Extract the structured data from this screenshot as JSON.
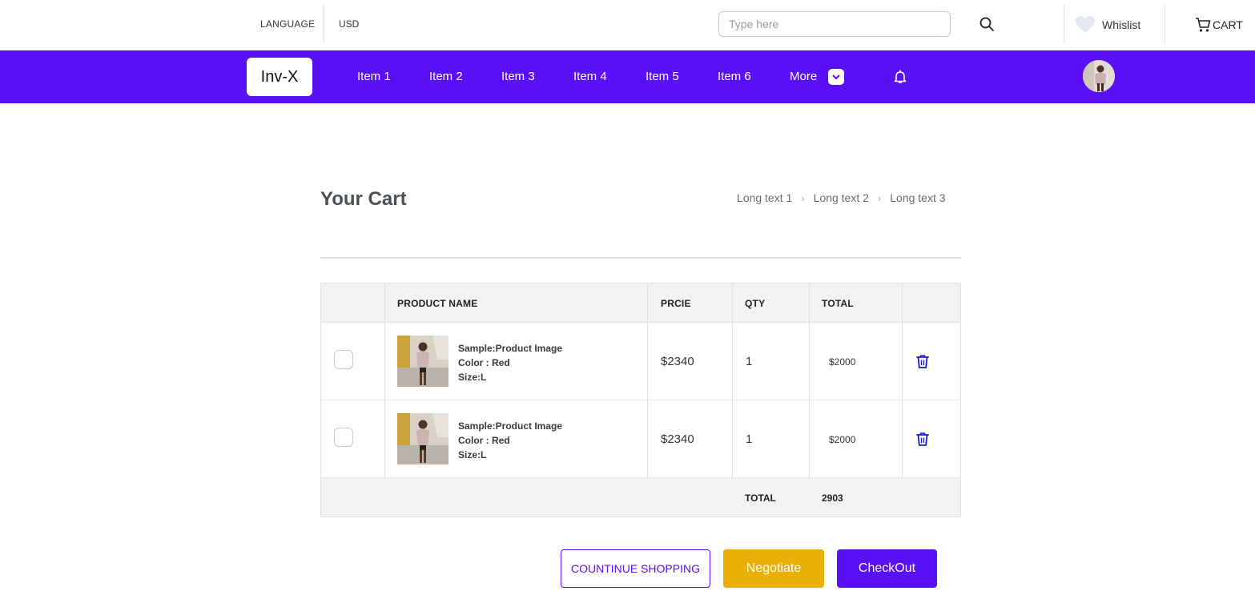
{
  "topbar": {
    "language_label": "LANGUAGE",
    "currency_label": "USD",
    "search_placeholder": "Type here",
    "wishlist_label": "Whislist",
    "cart_label": "CART"
  },
  "navbar": {
    "logo": "Inv-X",
    "items": [
      {
        "label": "Item 1"
      },
      {
        "label": "Item 2"
      },
      {
        "label": "Item 3"
      },
      {
        "label": "Item 4"
      },
      {
        "label": "Item 5"
      },
      {
        "label": "Item 6"
      }
    ],
    "more_label": "More",
    "accent_color": "#5a10f5"
  },
  "page": {
    "title": "Your Cart",
    "breadcrumb": [
      "Long text 1",
      "Long text 2",
      "Long text 3"
    ]
  },
  "table": {
    "headers": {
      "product": "PRODUCT NAME",
      "price": "PRCIE",
      "qty": "QTY",
      "total": "TOTAL"
    },
    "rows": [
      {
        "name": "Sample:Product Image",
        "color": "Color : Red",
        "size": "Size:L",
        "price": "$2340",
        "qty": "1",
        "total": "$2000"
      },
      {
        "name": "Sample:Product Image",
        "color": "Color : Red",
        "size": "Size:L",
        "price": "$2340",
        "qty": "1",
        "total": "$2000"
      }
    ],
    "footer": {
      "label": "TOTAL",
      "value": "2903"
    }
  },
  "actions": {
    "continue_label": "COUNTINUE SHOPPING",
    "negotiate_label": "Negotiate",
    "checkout_label": "CheckOut",
    "negotiate_color": "#e9b007"
  },
  "icons": [
    "search-icon",
    "heart-icon",
    "cart-icon",
    "chevron-down-icon",
    "bell-icon",
    "trash-icon"
  ]
}
